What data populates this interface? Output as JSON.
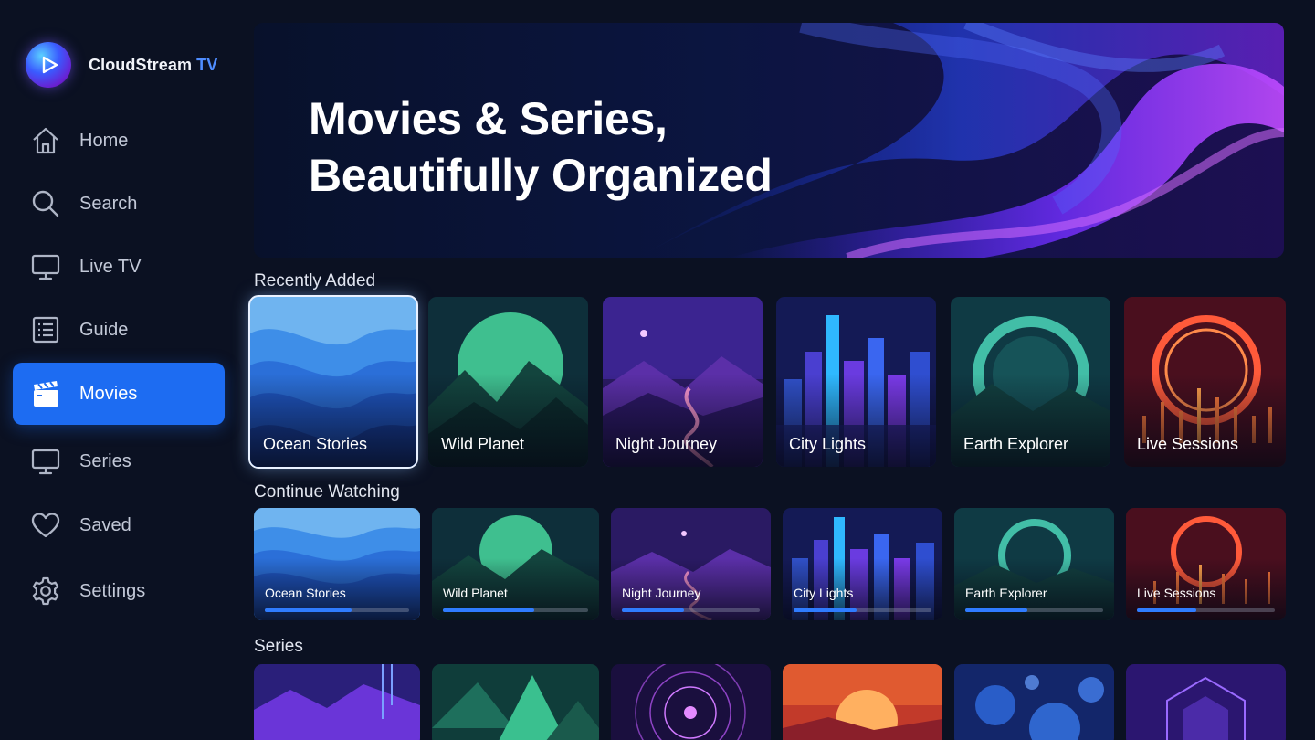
{
  "app": {
    "name": "CloudStream",
    "name_accent": "TV"
  },
  "sidebar": {
    "items": [
      {
        "label": "Home",
        "icon": "home-icon",
        "active": false
      },
      {
        "label": "Search",
        "icon": "search-icon",
        "active": false
      },
      {
        "label": "Live TV",
        "icon": "tv-icon",
        "active": false
      },
      {
        "label": "Guide",
        "icon": "guide-icon",
        "active": false
      },
      {
        "label": "Movies",
        "icon": "clapperboard-icon",
        "active": true
      },
      {
        "label": "Series",
        "icon": "monitor-icon",
        "active": false
      },
      {
        "label": "Saved",
        "icon": "heart-icon",
        "active": false
      },
      {
        "label": "Settings",
        "icon": "gear-icon",
        "active": false
      }
    ]
  },
  "hero": {
    "line1": "Movies & Series,",
    "line2": "Beautifully Organized"
  },
  "rows": {
    "recently_added": {
      "title": "Recently Added",
      "items": [
        {
          "label": "Ocean Stories",
          "focused": true
        },
        {
          "label": "Wild Planet"
        },
        {
          "label": "Night Journey"
        },
        {
          "label": "City Lights"
        },
        {
          "label": "Earth Explorer"
        },
        {
          "label": "Live Sessions"
        }
      ]
    },
    "continue_watching": {
      "title": "Continue Watching",
      "items": [
        {
          "label": "Ocean Stories",
          "progress": 0.6
        },
        {
          "label": "Wild Planet",
          "progress": 0.63
        },
        {
          "label": "Night Journey",
          "progress": 0.45
        },
        {
          "label": "City Lights",
          "progress": 0.46
        },
        {
          "label": "Earth Explorer",
          "progress": 0.45
        },
        {
          "label": "Live Sessions",
          "progress": 0.43
        }
      ]
    },
    "series": {
      "title": "Series"
    }
  },
  "colors": {
    "accent": "#1d6cf2",
    "background": "#0b1122",
    "progress": "#2f7cff"
  }
}
